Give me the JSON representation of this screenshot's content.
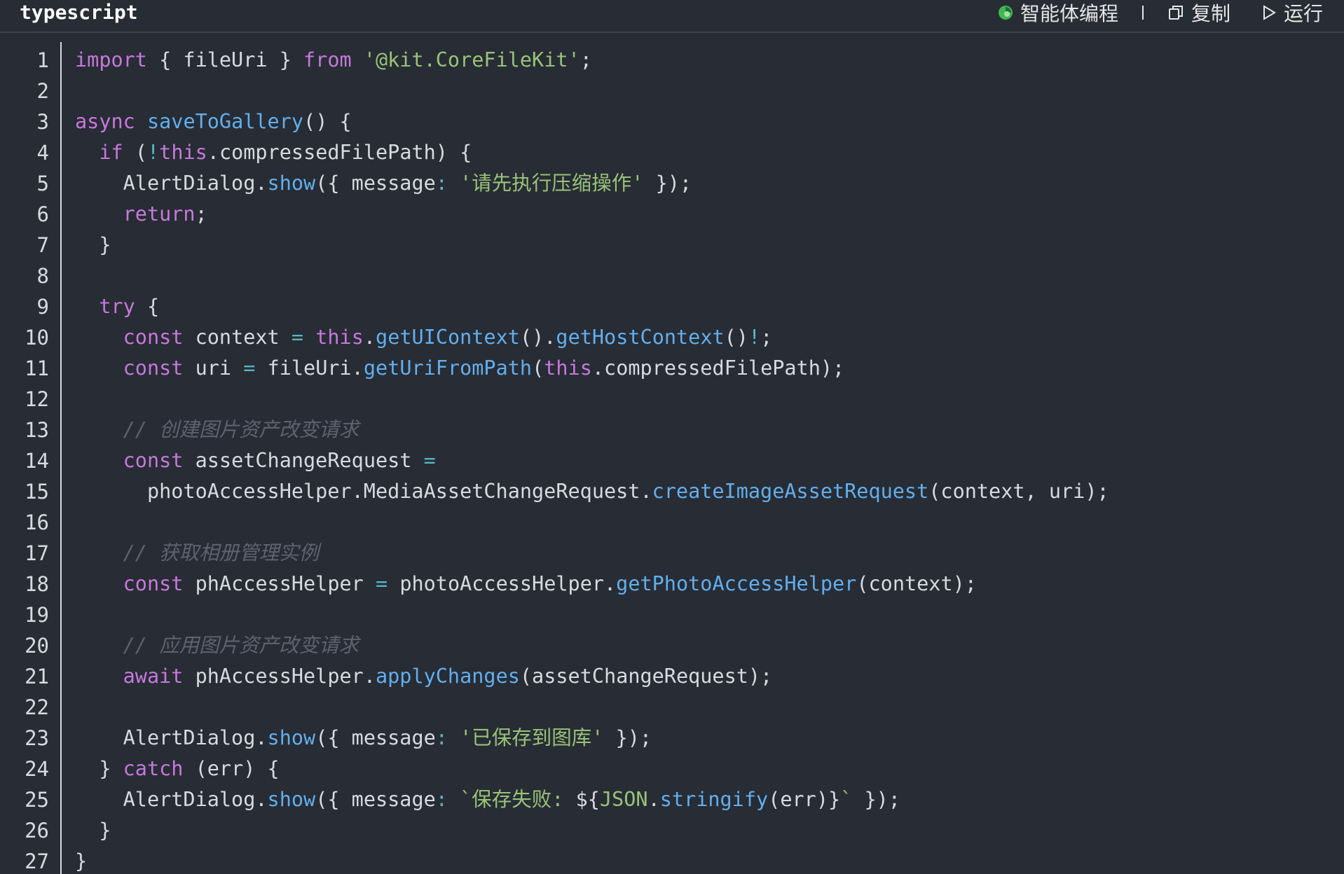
{
  "header": {
    "language": "typescript",
    "actions": [
      {
        "label": "智能体编程",
        "icon": "agent-logo-icon"
      },
      {
        "label": "复制",
        "icon": "copy-icon"
      },
      {
        "label": "运行",
        "icon": "play-icon"
      }
    ]
  },
  "colors": {
    "background": "#282c34",
    "keyword": "#c678dd",
    "function": "#61afef",
    "string": "#98c379",
    "comment": "#5c6370",
    "operator": "#56b6c2",
    "plain": "#d7dae0"
  },
  "code_lines": [
    [
      [
        "k",
        "import"
      ],
      [
        "n",
        " { fileUri } "
      ],
      [
        "k",
        "from"
      ],
      [
        "n",
        " "
      ],
      [
        "s",
        "'@kit.CoreFileKit'"
      ],
      [
        "n",
        ";"
      ]
    ],
    [],
    [
      [
        "k",
        "async"
      ],
      [
        "n",
        " "
      ],
      [
        "f",
        "saveToGallery"
      ],
      [
        "n",
        "() {"
      ]
    ],
    [
      [
        "n",
        "  "
      ],
      [
        "k",
        "if"
      ],
      [
        "n",
        " ("
      ],
      [
        "o",
        "!"
      ],
      [
        "k",
        "this"
      ],
      [
        "n",
        ".compressedFilePath) {"
      ]
    ],
    [
      [
        "n",
        "    AlertDialog."
      ],
      [
        "f",
        "show"
      ],
      [
        "n",
        "({ message"
      ],
      [
        "o",
        ":"
      ],
      [
        "n",
        " "
      ],
      [
        "s",
        "'请先执行压缩操作'"
      ],
      [
        "n",
        " });"
      ]
    ],
    [
      [
        "n",
        "    "
      ],
      [
        "k",
        "return"
      ],
      [
        "n",
        ";"
      ]
    ],
    [
      [
        "n",
        "  }"
      ]
    ],
    [],
    [
      [
        "n",
        "  "
      ],
      [
        "k",
        "try"
      ],
      [
        "n",
        " {"
      ]
    ],
    [
      [
        "n",
        "    "
      ],
      [
        "k",
        "const"
      ],
      [
        "n",
        " context "
      ],
      [
        "o",
        "="
      ],
      [
        "n",
        " "
      ],
      [
        "k",
        "this"
      ],
      [
        "n",
        "."
      ],
      [
        "f",
        "getUIContext"
      ],
      [
        "n",
        "()."
      ],
      [
        "f",
        "getHostContext"
      ],
      [
        "n",
        "()"
      ],
      [
        "o",
        "!"
      ],
      [
        "n",
        ";"
      ]
    ],
    [
      [
        "n",
        "    "
      ],
      [
        "k",
        "const"
      ],
      [
        "n",
        " uri "
      ],
      [
        "o",
        "="
      ],
      [
        "n",
        " fileUri."
      ],
      [
        "f",
        "getUriFromPath"
      ],
      [
        "n",
        "("
      ],
      [
        "k",
        "this"
      ],
      [
        "n",
        ".compressedFilePath);"
      ]
    ],
    [],
    [
      [
        "n",
        "    "
      ],
      [
        "c",
        "// 创建图片资产改变请求"
      ]
    ],
    [
      [
        "n",
        "    "
      ],
      [
        "k",
        "const"
      ],
      [
        "n",
        " assetChangeRequest "
      ],
      [
        "o",
        "="
      ]
    ],
    [
      [
        "n",
        "      photoAccessHelper.MediaAssetChangeRequest."
      ],
      [
        "f",
        "createImageAssetRequest"
      ],
      [
        "n",
        "(context, uri);"
      ]
    ],
    [],
    [
      [
        "n",
        "    "
      ],
      [
        "c",
        "// 获取相册管理实例"
      ]
    ],
    [
      [
        "n",
        "    "
      ],
      [
        "k",
        "const"
      ],
      [
        "n",
        " phAccessHelper "
      ],
      [
        "o",
        "="
      ],
      [
        "n",
        " photoAccessHelper."
      ],
      [
        "f",
        "getPhotoAccessHelper"
      ],
      [
        "n",
        "(context);"
      ]
    ],
    [],
    [
      [
        "n",
        "    "
      ],
      [
        "c",
        "// 应用图片资产改变请求"
      ]
    ],
    [
      [
        "n",
        "    "
      ],
      [
        "k",
        "await"
      ],
      [
        "n",
        " phAccessHelper."
      ],
      [
        "f",
        "applyChanges"
      ],
      [
        "n",
        "(assetChangeRequest);"
      ]
    ],
    [],
    [
      [
        "n",
        "    AlertDialog."
      ],
      [
        "f",
        "show"
      ],
      [
        "n",
        "({ message"
      ],
      [
        "o",
        ":"
      ],
      [
        "n",
        " "
      ],
      [
        "s",
        "'已保存到图库'"
      ],
      [
        "n",
        " });"
      ]
    ],
    [
      [
        "n",
        "  } "
      ],
      [
        "k",
        "catch"
      ],
      [
        "n",
        " (err) {"
      ]
    ],
    [
      [
        "n",
        "    AlertDialog."
      ],
      [
        "f",
        "show"
      ],
      [
        "n",
        "({ message"
      ],
      [
        "o",
        ":"
      ],
      [
        "n",
        " "
      ],
      [
        "s",
        "`保存失败: "
      ],
      [
        "n",
        "${"
      ],
      [
        "y",
        "JSON"
      ],
      [
        "n",
        "."
      ],
      [
        "f",
        "stringify"
      ],
      [
        "n",
        "(err)}"
      ],
      [
        "s",
        "`"
      ],
      [
        "n",
        " });"
      ]
    ],
    [
      [
        "n",
        "  }"
      ]
    ],
    [
      [
        "n",
        "}"
      ]
    ]
  ]
}
